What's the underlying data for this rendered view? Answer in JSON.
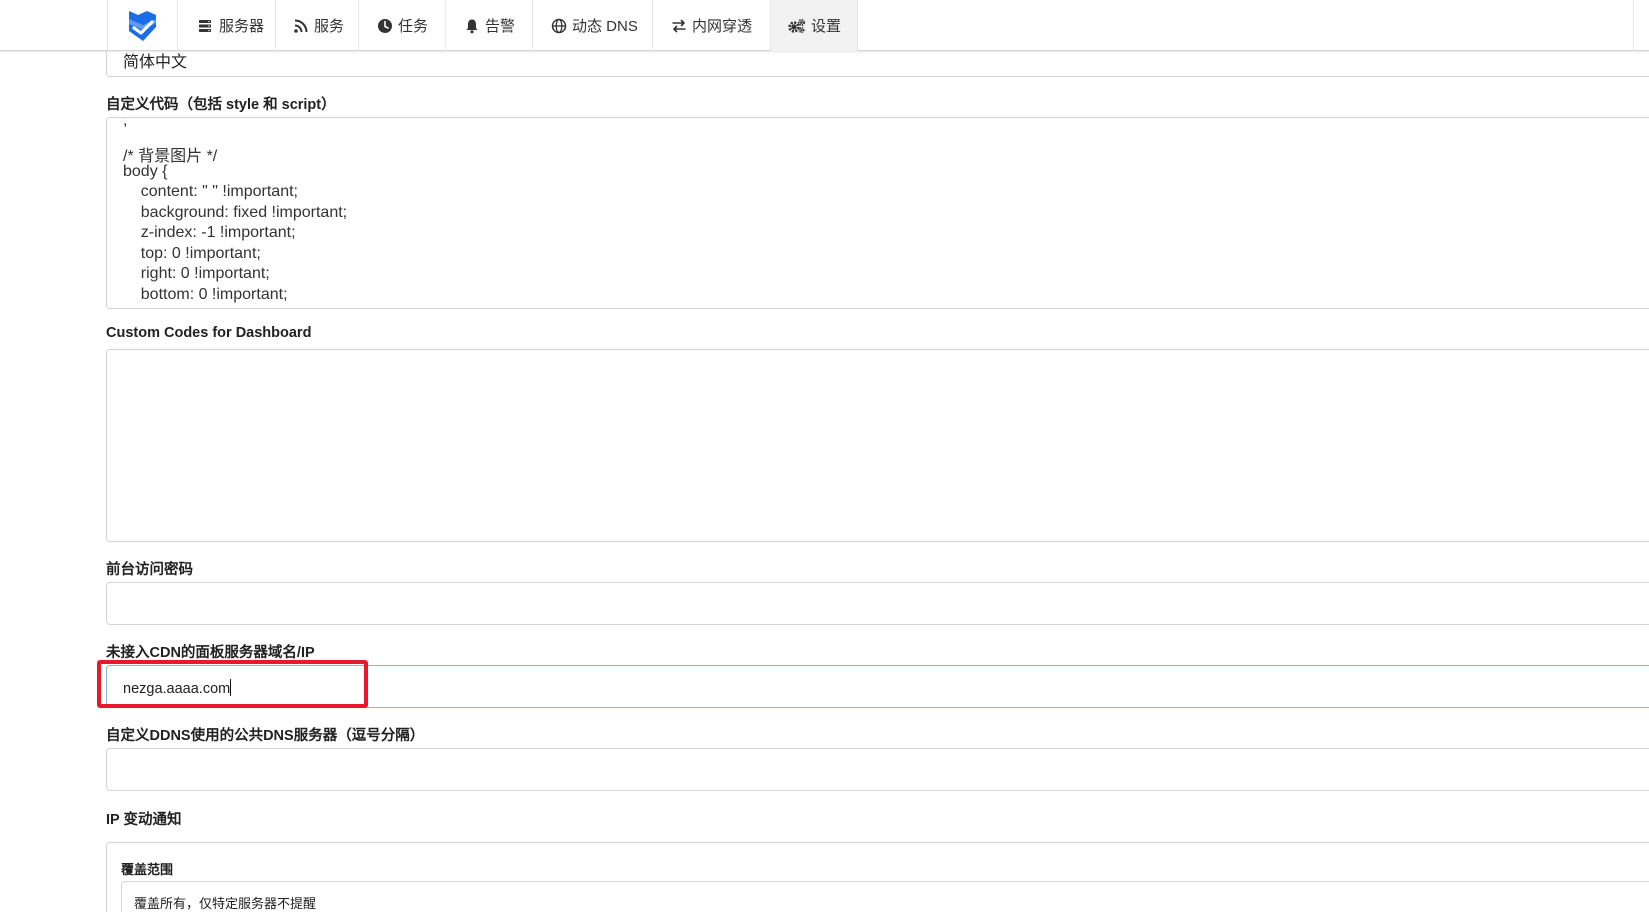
{
  "nav": {
    "items": [
      {
        "label": "服务器",
        "icon": "server-icon"
      },
      {
        "label": "服务",
        "icon": "rss-icon"
      },
      {
        "label": "任务",
        "icon": "clock-icon"
      },
      {
        "label": "告警",
        "icon": "bell-icon"
      },
      {
        "label": "动态 DNS",
        "icon": "globe-icon"
      },
      {
        "label": "内网穿透",
        "icon": "exchange-icon"
      },
      {
        "label": "设置",
        "icon": "cogs-icon",
        "active": true
      }
    ],
    "brand_color": "#1a6ce8"
  },
  "form": {
    "language_value": "简体中文",
    "custom_code": {
      "label": "自定义代码（包括 style 和 script）",
      "lines": [
        "/* 背景图片 */",
        "body {",
        "    content: \" \" !important;",
        "    background: fixed !important;",
        "    z-index: -1 !important;",
        "    top: 0 !important;",
        "    right: 0 !important;",
        "    bottom: 0 !important;"
      ]
    },
    "dashboard_code": {
      "label": "Custom Codes for Dashboard",
      "value": ""
    },
    "access_password": {
      "label": "前台访问密码",
      "value": ""
    },
    "domain": {
      "label": "未接入CDN的面板服务器域名/IP",
      "value": "nezga.aaaa.com"
    },
    "dns_servers": {
      "label": "自定义DDNS使用的公共DNS服务器（逗号分隔）",
      "value": ""
    },
    "ip_notify": {
      "label": "IP 变动通知",
      "scope_label": "覆盖范围",
      "scope_value": "覆盖所有，仅特定服务器不提醒"
    }
  },
  "colors": {
    "highlight": "#e8192c",
    "focus_border": "#85b7d9",
    "border": "#d4d4d5"
  }
}
